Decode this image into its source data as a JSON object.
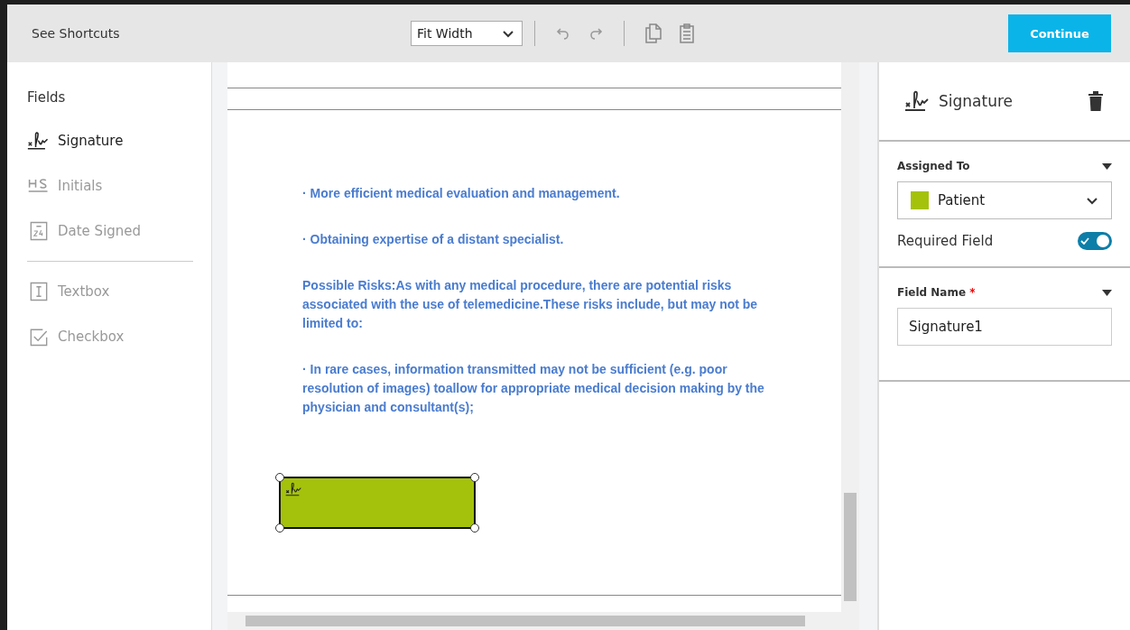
{
  "toolbar": {
    "shortcuts_link": "See Shortcuts",
    "zoom_select": "Fit Width",
    "continue_button": "Continue"
  },
  "sidebar": {
    "heading": "Fields",
    "groups": [
      [
        {
          "label": "Signature",
          "kind": "signature",
          "selected": true
        },
        {
          "label": "Initials",
          "kind": "initials",
          "selected": false
        },
        {
          "label": "Date Signed",
          "kind": "date",
          "selected": false
        }
      ],
      [
        {
          "label": "Textbox",
          "kind": "textbox",
          "selected": false
        },
        {
          "label": "Checkbox",
          "kind": "checkbox",
          "selected": false
        }
      ]
    ]
  },
  "document": {
    "paragraphs": [
      "· More efficient medical evaluation and management.",
      "· Obtaining expertise of a distant specialist.",
      "Possible Risks:As with any medical procedure, there are potential risks associated with the use of telemedicine.These risks include, but may not be limited to:",
      "· In rare cases, information transmitted may not be sufficient (e.g. poor resolution of images) toallow for appropriate medical decision making by the physician and consultant(s);"
    ]
  },
  "properties": {
    "title": "Signature",
    "assigned_to": {
      "label": "Assigned To",
      "value": "Patient",
      "color": "#a4c20b"
    },
    "required_field": {
      "label": "Required Field",
      "on": true
    },
    "field_name": {
      "label": "Field Name",
      "required_mark": "*",
      "value": "Signature1"
    }
  }
}
